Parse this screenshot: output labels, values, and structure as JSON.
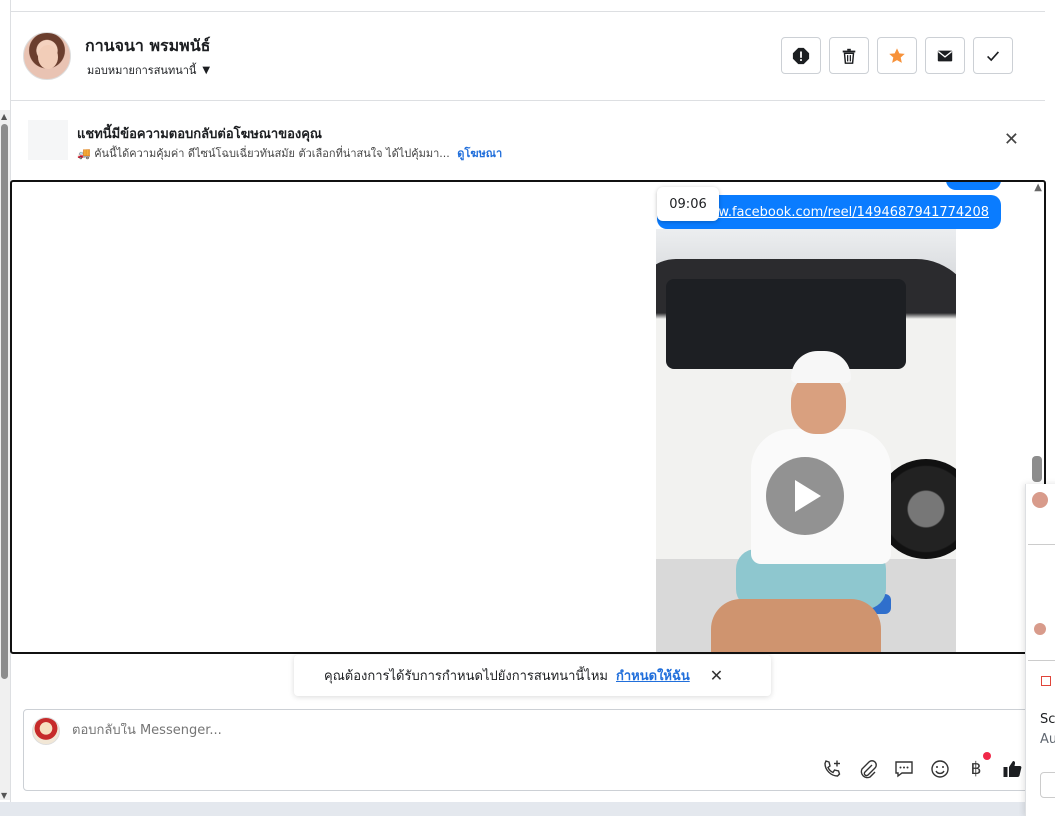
{
  "header": {
    "contact_name": "กานจนา พรมพนัธ์",
    "assign_label": "มอบหมายการสนทนานี้"
  },
  "toolbar": {
    "buttons": [
      "spam-alert-icon",
      "trash-icon",
      "star-icon",
      "mail-icon",
      "check-icon"
    ],
    "star_color": "#f7923a"
  },
  "ad_banner": {
    "title": "แชทนี้มีข้อความตอบกลับต่อโฆษณาของคุณ",
    "text": "คันนี้ได้ความคุ้มค่า ดีไซน์โฉบเฉี่ยวทันสมัย ตัวเลือกที่น่าสนใจ ได้ไปคุ้มมา...",
    "link": "ดูโฆษณา"
  },
  "messages": {
    "time": "09:06",
    "link_text": "www.facebook.com/reel/1494687941774208",
    "bubble_color": "#0a7cff"
  },
  "prompt": {
    "text": "คุณต้องการได้รับการกำหนดไปยังการสนทนานี้ไหม",
    "link": "กำหนดให้ฉัน"
  },
  "composer": {
    "placeholder": "ตอบกลับใน Messenger...",
    "baht_symbol": "฿"
  },
  "side_panel": {
    "line1": "Sc",
    "line2": "Au"
  }
}
